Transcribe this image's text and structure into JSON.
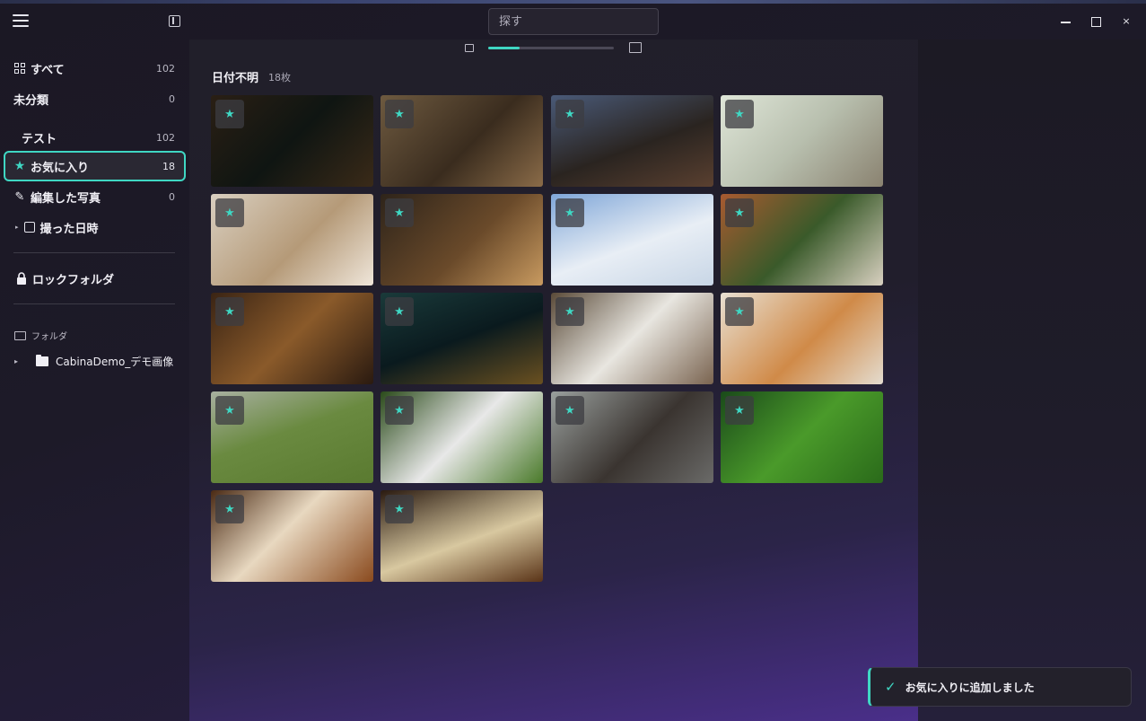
{
  "search": {
    "placeholder": "探す"
  },
  "window_controls": {
    "close": "×"
  },
  "sidebar": {
    "items": [
      {
        "label": "すべて",
        "count": "102"
      },
      {
        "label": "未分類",
        "count": "0"
      },
      {
        "label": "テスト",
        "count": "102"
      },
      {
        "label": "お気に入り",
        "count": "18"
      },
      {
        "label": "編集した写真",
        "count": "0"
      },
      {
        "label": "撮った日時"
      },
      {
        "label": "ロックフォルダ"
      }
    ],
    "folder_header": "フォルダ",
    "folder_item": "CabinaDemo_デモ画像"
  },
  "main": {
    "section_title": "日付不明",
    "section_count": "18枚",
    "zoom_level": 0.25,
    "thumbnails": [
      {
        "subject": "night street",
        "bg": "linear-gradient(135deg,#2a1f14,#0f1512 50%,#3a2a18)"
      },
      {
        "subject": "desk with book",
        "bg": "linear-gradient(135deg,#6e5a40,#3a2c1e 55%,#8a6b48)"
      },
      {
        "subject": "rainy town street",
        "bg": "linear-gradient(160deg,#4a5a78,#2a2420 55%,#5a4030)"
      },
      {
        "subject": "cat at window",
        "bg": "linear-gradient(135deg,#dfe6d8,#b8bfae 50%,#8a8270)"
      },
      {
        "subject": "sleeping cat on blanket",
        "bg": "linear-gradient(135deg,#d9cfc0,#b59a78 55%,#efe6da)"
      },
      {
        "subject": "coffee and croissant",
        "bg": "linear-gradient(135deg,#2e241a,#6a4a2a 55%,#c89a60)"
      },
      {
        "subject": "snowy forest",
        "bg": "linear-gradient(160deg,#7fa6d8,#e8eef5 55%,#c8d6e6)"
      },
      {
        "subject": "red scooter",
        "bg": "linear-gradient(135deg,#a85a30,#3a5a2a 50%,#d8d0c0)"
      },
      {
        "subject": "bookshelf",
        "bg": "linear-gradient(135deg,#3a2414,#8a5a2a 50%,#2a1a10)"
      },
      {
        "subject": "glowing cave",
        "bg": "linear-gradient(160deg,#1a3a3a,#0a1a1e 50%,#6a5020)"
      },
      {
        "subject": "watercolor sketchbook",
        "bg": "linear-gradient(135deg,#5a4a38,#e8e6e0 50%,#7a6450)"
      },
      {
        "subject": "sleeping orange cat",
        "bg": "linear-gradient(135deg,#e8e0d2,#d08a48 55%,#e4dccf)"
      },
      {
        "subject": "dog on grass",
        "bg": "linear-gradient(160deg,#a8b0a0,#6a8a40 45%,#5a7a30)"
      },
      {
        "subject": "white rabbit",
        "bg": "linear-gradient(135deg,#2a4a1a,#e8e8e8 50%,#4a7a2a)"
      },
      {
        "subject": "cat by rainy window",
        "bg": "linear-gradient(135deg,#9aa09e,#3a3430 55%,#6a6a68)"
      },
      {
        "subject": "ladybug on leaf",
        "bg": "linear-gradient(135deg,#1a4a1a,#4a9a2a 50%,#2a6a1a)"
      },
      {
        "subject": "cake and iced tea",
        "bg": "linear-gradient(135deg,#4a2a14,#e8d8c0 45%,#8a4a1e)"
      },
      {
        "subject": "ramen bowl",
        "bg": "linear-gradient(160deg,#2a1a10,#d8c8a0 55%,#5a3418)"
      }
    ]
  },
  "toast": {
    "message": "お気に入りに追加しました"
  },
  "colors": {
    "accent": "#3fd7c3"
  }
}
